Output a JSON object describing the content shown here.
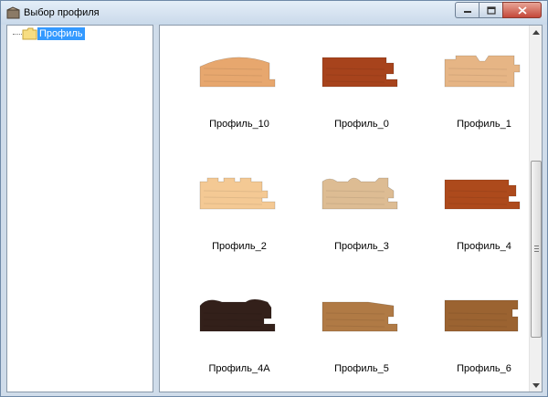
{
  "window": {
    "title": "Выбор профиля"
  },
  "tree": {
    "root_label": "Профиль"
  },
  "colors": {
    "selection": "#3399ff",
    "frame": "#cfdcea",
    "close_button": "#c4483a"
  },
  "profiles": [
    {
      "label": "Профиль_10",
      "shape": "rounded-top",
      "color": "#e7a76e"
    },
    {
      "label": "Профиль_0",
      "shape": "tongue-groove",
      "color": "#a7431c"
    },
    {
      "label": "Профиль_1",
      "shape": "notched-top",
      "color": "#e6b585"
    },
    {
      "label": "Профиль_2",
      "shape": "crenellated",
      "color": "#f4c994"
    },
    {
      "label": "Профиль_3",
      "shape": "bead-groove",
      "color": "#ddbc93"
    },
    {
      "label": "Профиль_4",
      "shape": "tongue-groove",
      "color": "#ad4a1c"
    },
    {
      "label": "Профиль_4А",
      "shape": "curved-lip",
      "color": "#33201a"
    },
    {
      "label": "Профиль_5",
      "shape": "sloped-top",
      "color": "#b07a45"
    },
    {
      "label": "Профиль_6",
      "shape": "flat-board",
      "color": "#9b6331"
    }
  ]
}
